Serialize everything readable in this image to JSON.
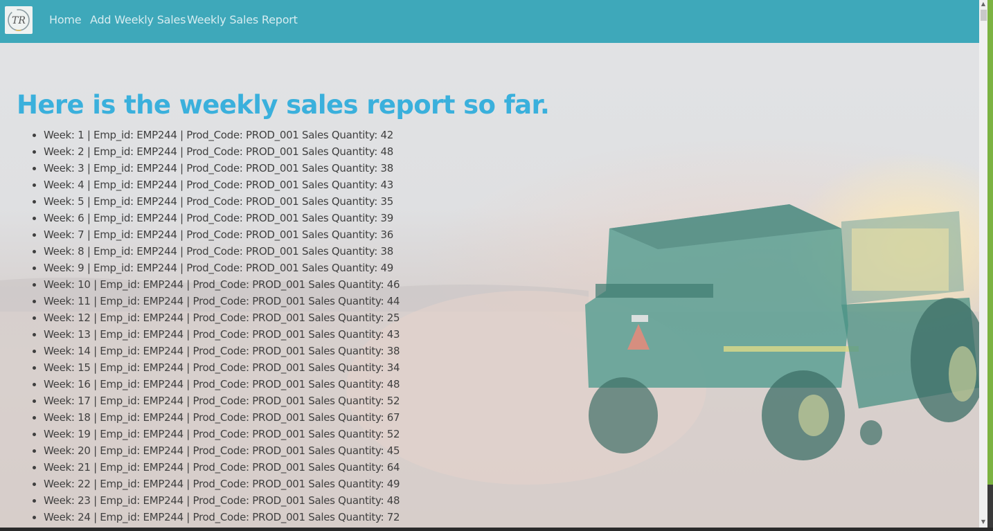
{
  "nav": {
    "home_label": "Home",
    "add_label": "Add Weekly Sales",
    "report_label": "Weekly Sales Report"
  },
  "brand": {
    "initials": "TR"
  },
  "page": {
    "title": "Here is the weekly sales report so far."
  },
  "sales": [
    "Week: 1 | Emp_id: EMP244 | Prod_Code: PROD_001 Sales Quantity: 42",
    "Week: 2 | Emp_id: EMP244 | Prod_Code: PROD_001 Sales Quantity: 48",
    "Week: 3 | Emp_id: EMP244 | Prod_Code: PROD_001 Sales Quantity: 38",
    "Week: 4 | Emp_id: EMP244 | Prod_Code: PROD_001 Sales Quantity: 43",
    "Week: 5 | Emp_id: EMP244 | Prod_Code: PROD_001 Sales Quantity: 35",
    "Week: 6 | Emp_id: EMP244 | Prod_Code: PROD_001 Sales Quantity: 39",
    "Week: 7 | Emp_id: EMP244 | Prod_Code: PROD_001 Sales Quantity: 36",
    "Week: 8 | Emp_id: EMP244 | Prod_Code: PROD_001 Sales Quantity: 38",
    "Week: 9 | Emp_id: EMP244 | Prod_Code: PROD_001 Sales Quantity: 49",
    "Week: 10 | Emp_id: EMP244 | Prod_Code: PROD_001 Sales Quantity: 46",
    "Week: 11 | Emp_id: EMP244 | Prod_Code: PROD_001 Sales Quantity: 44",
    "Week: 12 | Emp_id: EMP244 | Prod_Code: PROD_001 Sales Quantity: 25",
    "Week: 13 | Emp_id: EMP244 | Prod_Code: PROD_001 Sales Quantity: 43",
    "Week: 14 | Emp_id: EMP244 | Prod_Code: PROD_001 Sales Quantity: 38",
    "Week: 15 | Emp_id: EMP244 | Prod_Code: PROD_001 Sales Quantity: 34",
    "Week: 16 | Emp_id: EMP244 | Prod_Code: PROD_001 Sales Quantity: 48",
    "Week: 17 | Emp_id: EMP244 | Prod_Code: PROD_001 Sales Quantity: 52",
    "Week: 18 | Emp_id: EMP244 | Prod_Code: PROD_001 Sales Quantity: 67",
    "Week: 19 | Emp_id: EMP244 | Prod_Code: PROD_001 Sales Quantity: 52",
    "Week: 20 | Emp_id: EMP244 | Prod_Code: PROD_001 Sales Quantity: 45",
    "Week: 21 | Emp_id: EMP244 | Prod_Code: PROD_001 Sales Quantity: 64",
    "Week: 22 | Emp_id: EMP244 | Prod_Code: PROD_001 Sales Quantity: 49",
    "Week: 23 | Emp_id: EMP244 | Prod_Code: PROD_001 Sales Quantity: 48",
    "Week: 24 | Emp_id: EMP244 | Prod_Code: PROD_001 Sales Quantity: 72"
  ],
  "colors": {
    "navbar": "#3ea8ba",
    "title": "#3ab0dc",
    "text": "#3f3f3f"
  },
  "icons": {
    "scroll_up": "scroll-up-arrow-icon",
    "scroll_down": "scroll-down-arrow-icon"
  }
}
